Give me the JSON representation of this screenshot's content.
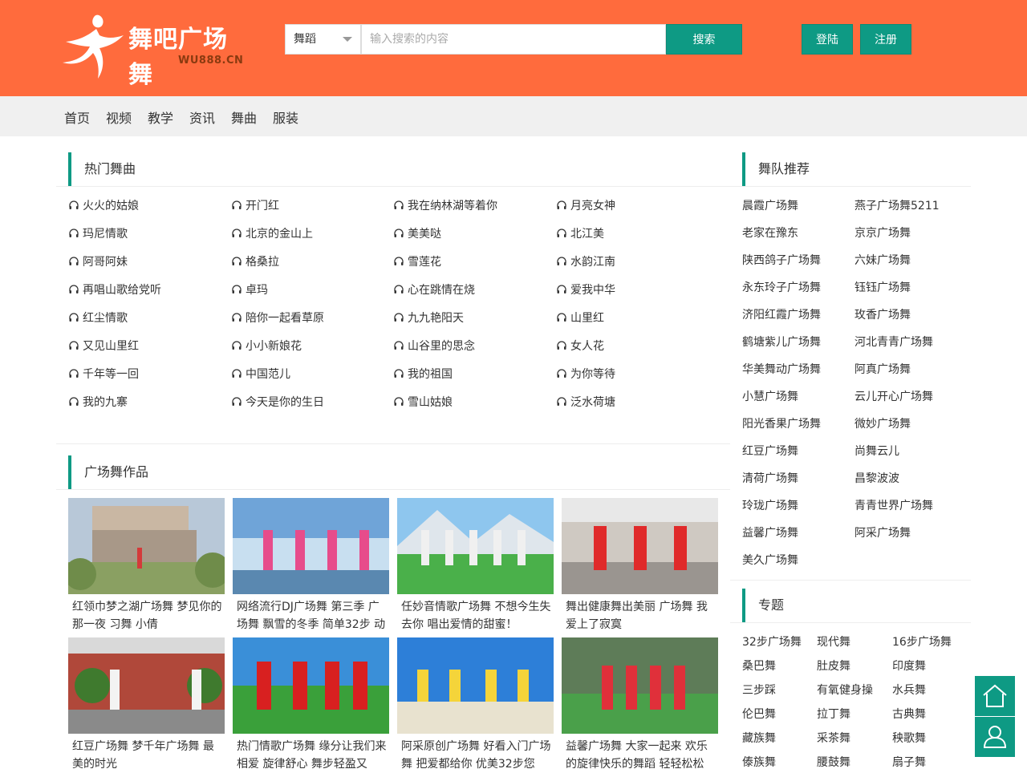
{
  "brand": {
    "name": "舞吧广场舞",
    "domain": "WU888.CN"
  },
  "search": {
    "category": "舞蹈",
    "placeholder": "输入搜索的内容",
    "button": "搜索"
  },
  "auth": {
    "login": "登陆",
    "register": "注册"
  },
  "nav": [
    "首页",
    "视频",
    "教学",
    "资讯",
    "舞曲",
    "服装"
  ],
  "hot_songs": {
    "title": "热门舞曲",
    "items": [
      "火火的姑娘",
      "开门红",
      "我在纳林湖等着你",
      "月亮女神",
      "玛尼情歌",
      "北京的金山上",
      "美美哒",
      "北江美",
      "阿哥阿妹",
      "格桑拉",
      "雪莲花",
      "水韵江南",
      "再唱山歌给党听",
      "卓玛",
      "心在跳情在烧",
      "爱我中华",
      "红尘情歌",
      "陪你一起看草原",
      "九九艳阳天",
      "山里红",
      "又见山里红",
      "小小新娘花",
      "山谷里的思念",
      "女人花",
      "千年等一回",
      "中国范儿",
      "我的祖国",
      "为你等待",
      "我的九寨",
      "今天是你的生日",
      "雪山姑娘",
      "泛水荷塘"
    ]
  },
  "works": {
    "title": "广场舞作品",
    "items": [
      {
        "caption": "红领巾梦之湖广场舞 梦见你的那一夜 习舞 小倩"
      },
      {
        "caption": "网络流行DJ广场舞 第三季 广场舞 飘雪的冬季 简单32步 动"
      },
      {
        "caption": "任妙音情歌广场舞 不想今生失去你 唱出爱情的甜蜜！"
      },
      {
        "caption": "舞出健康舞出美丽 广场舞 我爱上了寂寞"
      },
      {
        "caption": "红豆广场舞 梦千年广场舞 最美的时光"
      },
      {
        "caption": "热门情歌广场舞 缘分让我们来相爱 旋律舒心 舞步轻盈又"
      },
      {
        "caption": "阿采原创广场舞 好看入门广场舞 把爱都给你 优美32步您"
      },
      {
        "caption": "益馨广场舞 大家一起来 欢乐的旋律快乐的舞蹈 轻轻松松"
      }
    ]
  },
  "teams": {
    "title": "舞队推荐",
    "items": [
      "晨霞广场舞",
      "燕子广场舞5211",
      "老家在豫东",
      "京京广场舞",
      "陕西鸽子广场舞",
      "六妹广场舞",
      "永东玲子广场舞",
      "钰钰广场舞",
      "济阳红霞广场舞",
      "玫香广场舞",
      "鹤塘紫儿广场舞",
      "河北青青广场舞",
      "华美舞动广场舞",
      "阿真广场舞",
      "小慧广场舞",
      "云儿开心广场舞",
      "阳光香果广场舞",
      "微妙广场舞",
      "红豆广场舞",
      "尚舞云儿",
      "清荷广场舞",
      "昌黎波波",
      "玲珑广场舞",
      "青青世界广场舞",
      "益馨广场舞",
      "阿采广场舞",
      "美久广场舞"
    ]
  },
  "topics": {
    "title": "专题",
    "items": [
      "32步广场舞",
      "现代舞",
      "16步广场舞",
      "桑巴舞",
      "肚皮舞",
      "印度舞",
      "三步踩",
      "有氧健身操",
      "水兵舞",
      "伦巴舞",
      "拉丁舞",
      "古典舞",
      "藏族舞",
      "采茶舞",
      "秧歌舞",
      "傣族舞",
      "腰鼓舞",
      "扇子舞"
    ]
  },
  "colors": {
    "header": "#ff6b3d",
    "accent": "#0e9a84",
    "nav_bg": "#f0f0f0"
  }
}
